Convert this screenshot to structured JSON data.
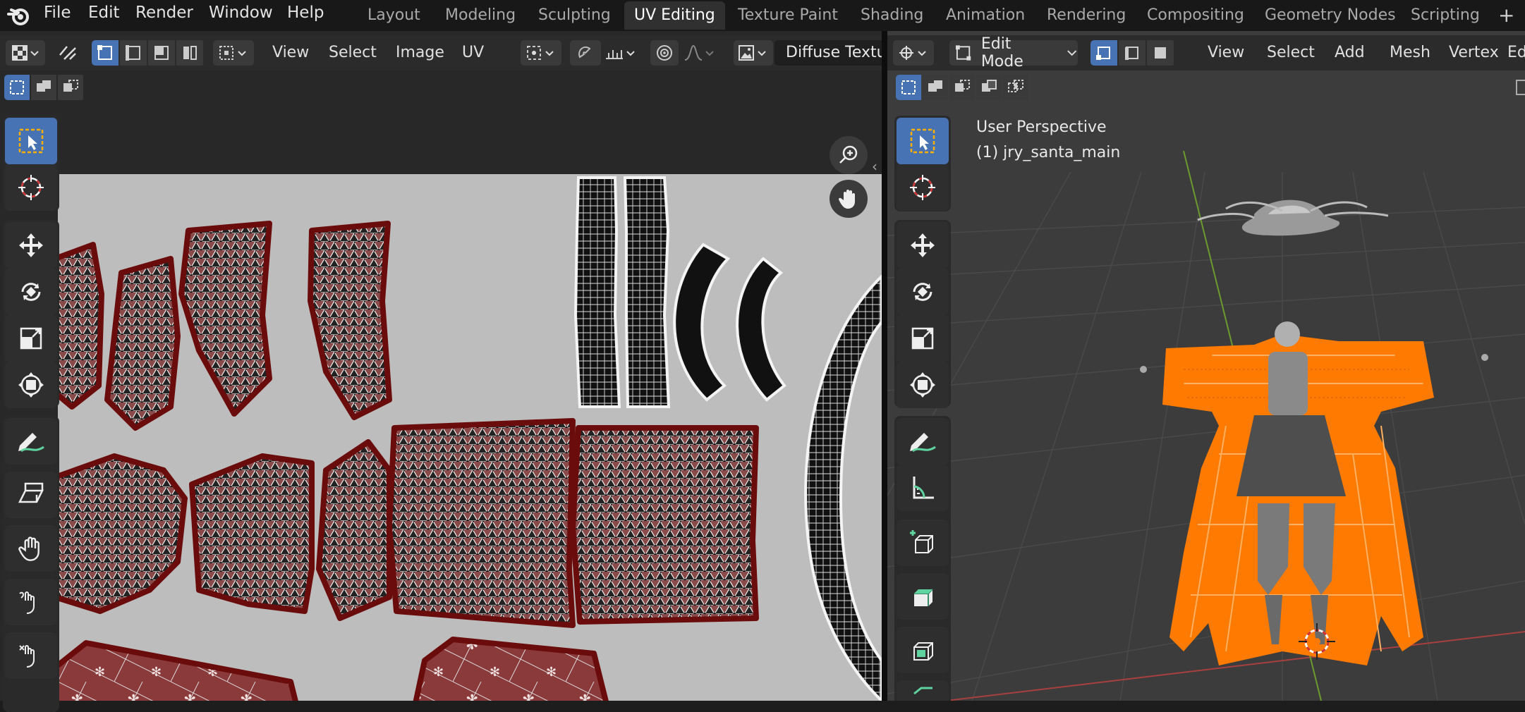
{
  "app": {
    "menus": [
      "File",
      "Edit",
      "Render",
      "Window",
      "Help"
    ],
    "workspaces": [
      "Layout",
      "Modeling",
      "Sculpting",
      "UV Editing",
      "Texture Paint",
      "Shading",
      "Animation",
      "Rendering",
      "Compositing",
      "Geometry Nodes",
      "Scripting"
    ],
    "active_workspace": "UV Editing",
    "add_workspace": "+"
  },
  "uv_editor": {
    "header_menus": [
      "View",
      "Select",
      "Image",
      "UV"
    ],
    "image_name": "Diffuse Textu"
  },
  "viewport": {
    "mode": "Edit Mode",
    "header_menus": [
      "View",
      "Select",
      "Add",
      "Mesh",
      "Vertex",
      "Edge"
    ],
    "perspective_label": "User Perspective",
    "object_label": "(1) jry_santa_main"
  },
  "colors": {
    "accent": "#4772b3",
    "selection_orange": "#ff7a00",
    "uv_background": "#bdbdbd",
    "island_border": "#6b0c0c"
  }
}
